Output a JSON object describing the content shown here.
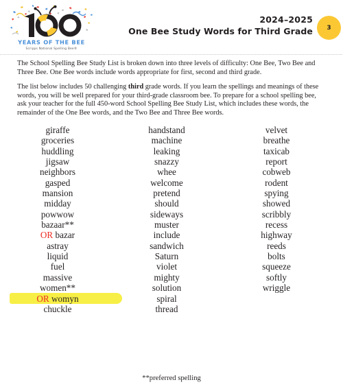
{
  "header": {
    "logo_alt": "100 Years of the Bee — Scripps National Spelling Bee",
    "logo_number": "100",
    "logo_tagline": "YEARS OF THE BEE",
    "logo_subtagline": "Scripps National Spelling Bee®",
    "year": "2024–2025",
    "title": "One Bee Study Words for Third Grade",
    "page_number": "3",
    "badge_color": "#fbc834"
  },
  "intro": {
    "paragraph_1": "The School Spelling Bee Study List is broken down into three levels of difficulty: One Bee, Two Bee and Three Bee. One Bee words include words appropriate for first, second and third grade.",
    "paragraph_2_before": "The list below includes 50 challenging ",
    "paragraph_2_bold": "third",
    "paragraph_2_after": " grade words. If you learn the spellings and meanings of these words, you will be well prepared for your third-grade classroom bee. To prepare for a school spelling bee, ask your teacher for the full 450-word School Spelling Bee Study List, which includes these words, the remainder of the One Bee words, and the Two Bee and Three Bee words."
  },
  "word_list": {
    "or_label": "OR",
    "or_color": "#ee2b24",
    "highlight_color": "#f7ef46",
    "columns": [
      {
        "name": "column-1",
        "words": [
          {
            "text": "giraffe"
          },
          {
            "text": "groceries"
          },
          {
            "text": "huddling"
          },
          {
            "text": "jigsaw"
          },
          {
            "text": "neighbors"
          },
          {
            "text": "gasped"
          },
          {
            "text": "mansion"
          },
          {
            "text": "midday"
          },
          {
            "text": "powwow"
          },
          {
            "text": "bazaar**"
          },
          {
            "text": "bazar",
            "or": true
          },
          {
            "text": "astray"
          },
          {
            "text": "liquid"
          },
          {
            "text": "fuel"
          },
          {
            "text": "massive"
          },
          {
            "text": "women**"
          },
          {
            "text": "womyn",
            "or": true,
            "highlighted": true
          },
          {
            "text": "chuckle"
          }
        ]
      },
      {
        "name": "column-2",
        "words": [
          {
            "text": "handstand"
          },
          {
            "text": "machine"
          },
          {
            "text": "leaking"
          },
          {
            "text": "snazzy"
          },
          {
            "text": "whee"
          },
          {
            "text": "welcome"
          },
          {
            "text": "pretend"
          },
          {
            "text": "should"
          },
          {
            "text": "sideways"
          },
          {
            "text": "muster"
          },
          {
            "text": "include"
          },
          {
            "text": "sandwich"
          },
          {
            "text": "Saturn"
          },
          {
            "text": "violet"
          },
          {
            "text": "mighty"
          },
          {
            "text": "solution"
          },
          {
            "text": "spiral"
          },
          {
            "text": "thread"
          }
        ]
      },
      {
        "name": "column-3",
        "words": [
          {
            "text": "velvet"
          },
          {
            "text": "breathe"
          },
          {
            "text": "taxicab"
          },
          {
            "text": "report"
          },
          {
            "text": "cobweb"
          },
          {
            "text": "rodent"
          },
          {
            "text": "spying"
          },
          {
            "text": "showed"
          },
          {
            "text": "scribbly"
          },
          {
            "text": "recess"
          },
          {
            "text": "highway"
          },
          {
            "text": "reeds"
          },
          {
            "text": "bolts"
          },
          {
            "text": "squeeze"
          },
          {
            "text": "softly"
          },
          {
            "text": "wriggle"
          }
        ]
      }
    ]
  },
  "footer": {
    "note": "**preferred spelling"
  }
}
